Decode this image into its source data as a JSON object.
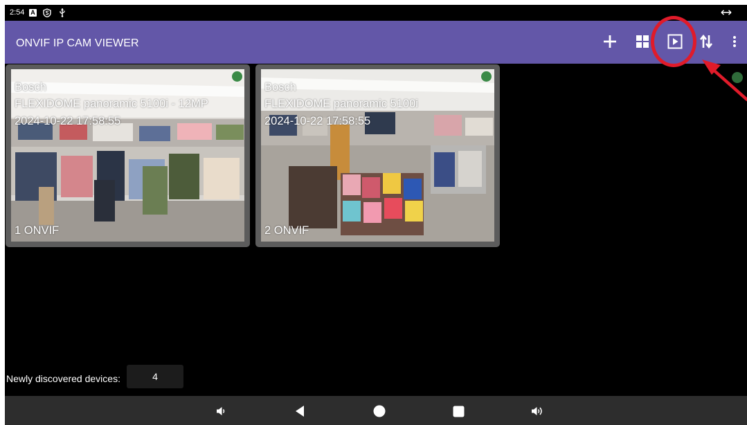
{
  "status_bar": {
    "time": "2:54",
    "icons": [
      "accessibility-a-icon",
      "shield-s-icon",
      "usb-icon",
      "resize-arrows-icon"
    ],
    "a_glyph": "A"
  },
  "app_bar": {
    "title": "ONVIF IP CAM VIEWER",
    "actions": [
      "add-icon",
      "grid-icon",
      "play-icon",
      "sort-icon",
      "more-vert-icon"
    ],
    "color": "#6357a8"
  },
  "cameras": [
    {
      "brand": "Bosch",
      "model": "FLEXIDOME panoramic 5100i - 12MP",
      "timestamp": "2024-10-22 17:58:55",
      "label": "1 ONVIF",
      "status_color": "#3a8a46"
    },
    {
      "brand": "Bosch",
      "model": "FLEXIDOME panoramic 5100i",
      "timestamp": "2024-10-22 17:58:55",
      "label": "2 ONVIF",
      "status_color": "#3a8a46"
    }
  ],
  "discovered": {
    "label": "Newly discovered devices:",
    "count": "4"
  },
  "nav_bar": {
    "buttons": [
      "volume-down-icon",
      "back-icon",
      "home-icon",
      "recents-icon",
      "volume-up-icon"
    ]
  },
  "annotation": {
    "color": "#e01b2a"
  }
}
